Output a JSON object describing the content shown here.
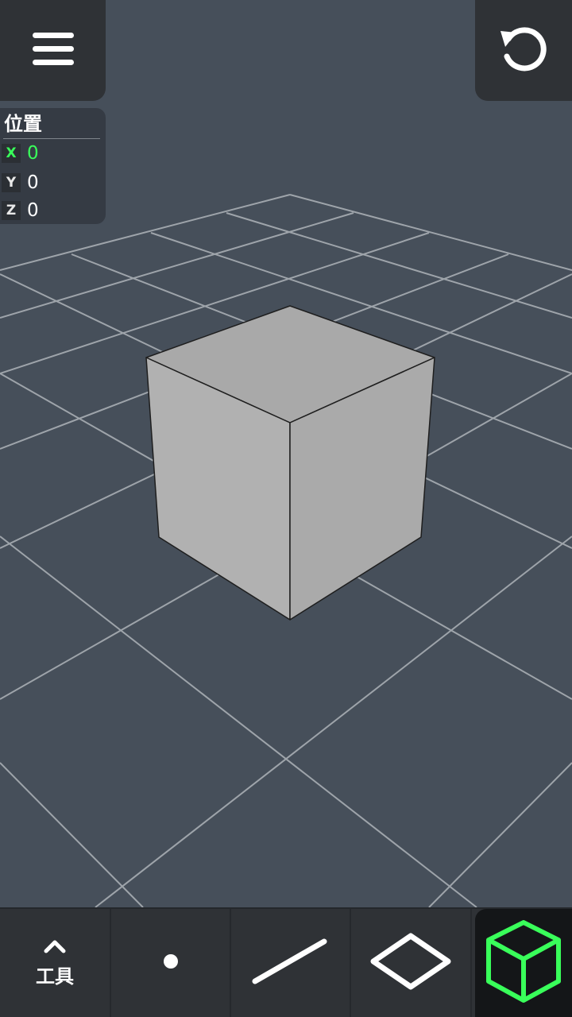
{
  "header": {
    "menu_icon": "hamburger-menu-icon",
    "undo_icon": "undo-icon"
  },
  "position_panel": {
    "title": "位置",
    "axes": [
      {
        "label": "X",
        "value": "0",
        "active": true
      },
      {
        "label": "Y",
        "value": "0",
        "active": false
      },
      {
        "label": "Z",
        "value": "0",
        "active": false
      }
    ]
  },
  "toolbar": {
    "toggle_label": "工具",
    "toggle_icon": "chevron-up-icon",
    "tools": [
      {
        "name": "point",
        "icon": "point-icon",
        "active": false
      },
      {
        "name": "line",
        "icon": "line-icon",
        "active": false
      },
      {
        "name": "plane",
        "icon": "plane-icon",
        "active": false
      },
      {
        "name": "cube",
        "icon": "cube-icon",
        "active": true
      }
    ]
  },
  "colors": {
    "background": "#464f5a",
    "panel": "#2f3236",
    "accent": "#39ff5a",
    "grid": "#b8bcc2",
    "cube": "#adadad"
  }
}
